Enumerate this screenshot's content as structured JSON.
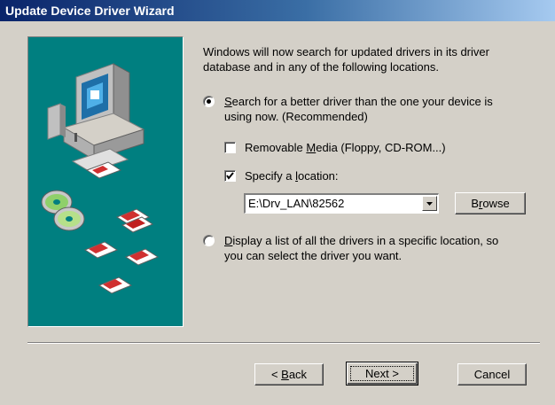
{
  "window": {
    "title": "Update Device Driver Wizard"
  },
  "intro": {
    "text": "Windows will now search for updated drivers in its driver database and in any of the following locations."
  },
  "options": {
    "search": {
      "selected": true,
      "label_pre": "",
      "label_accel": "S",
      "label_post": "earch for a better driver than the one your device is",
      "label_line2": "using now. (Recommended)"
    },
    "removable_media": {
      "checked": false,
      "label_pre": "Removable ",
      "label_accel": "M",
      "label_post": "edia (Floppy, CD-ROM...)"
    },
    "specify_location": {
      "checked": true,
      "label_pre": "Specify a ",
      "label_accel": "l",
      "label_post": "ocation:"
    },
    "location_value": "E:\\Drv_LAN\\82562",
    "display_list": {
      "selected": false,
      "label_pre": "",
      "label_accel": "D",
      "label_post": "isplay a list of all the drivers in a specific location, so",
      "label_line2": "you can select the driver you want."
    }
  },
  "buttons": {
    "browse": {
      "pre": "B",
      "accel": "r",
      "post": "owse"
    },
    "back": {
      "pre": "< ",
      "accel": "B",
      "post": "ack"
    },
    "next": "Next >",
    "cancel": "Cancel"
  },
  "colors": {
    "art_background": "#007f80",
    "dialog_face": "#d4d0c8",
    "title_start": "#0a246a"
  },
  "icons": [
    "computer-icon",
    "cd-icon",
    "floppy-disk-icon",
    "dropdown-arrow-icon",
    "checkmark-icon"
  ]
}
